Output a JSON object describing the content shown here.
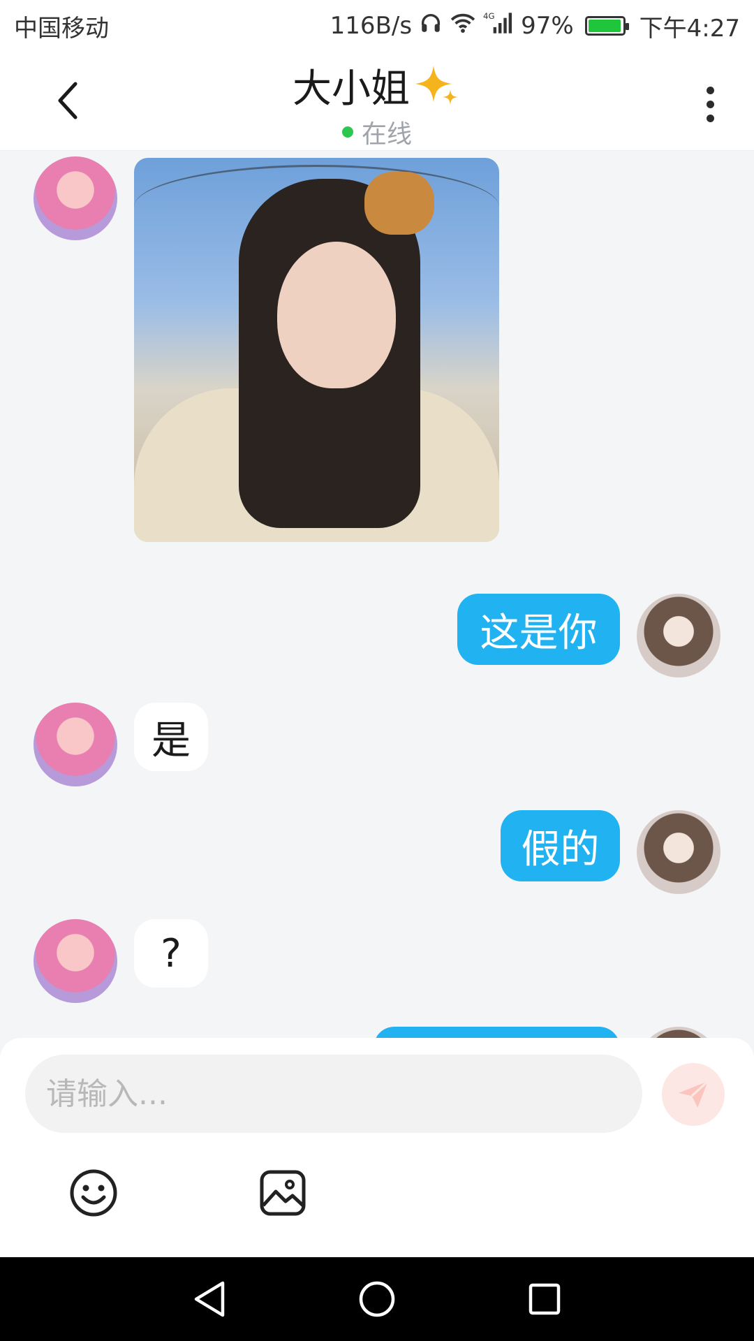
{
  "status_bar": {
    "carrier": "中国移动",
    "speed": "116B/s",
    "network": "4G",
    "battery": "97%",
    "battery_level": 0.97,
    "time": "下午4:27"
  },
  "header": {
    "title": "大小姐",
    "status": "在线",
    "status_color": "#2bc84d"
  },
  "messages": [
    {
      "side": "in",
      "type": "image",
      "alt": ""
    },
    {
      "side": "out",
      "type": "text",
      "text": "这是你"
    },
    {
      "side": "in",
      "type": "text",
      "text": "是"
    },
    {
      "side": "out",
      "type": "text",
      "text": "假的"
    },
    {
      "side": "in",
      "type": "text",
      "text": "?"
    }
  ],
  "composer": {
    "placeholder": "请输入..."
  },
  "colors": {
    "outgoing_bubble": "#21b2f1",
    "incoming_bubble": "#ffffff",
    "background": "#f4f5f7"
  },
  "icons": {
    "back": "chevron-left-icon",
    "more": "more-vertical-icon",
    "send": "send-icon",
    "emoji": "emoji-icon",
    "image": "image-icon"
  }
}
